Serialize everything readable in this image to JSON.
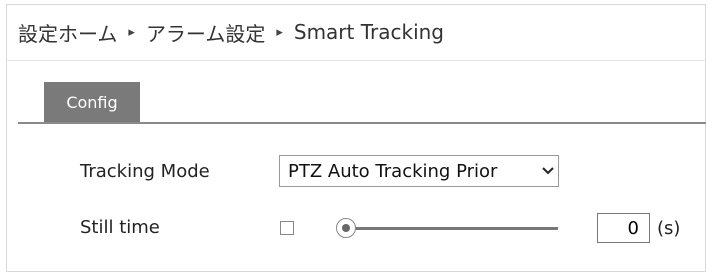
{
  "breadcrumb": {
    "items": [
      "設定ホーム",
      "アラーム設定",
      "Smart Tracking"
    ],
    "separator": "▸"
  },
  "tabs": [
    {
      "label": "Config",
      "active": true
    }
  ],
  "form": {
    "tracking_mode": {
      "label": "Tracking Mode",
      "value": "PTZ Auto Tracking Prior"
    },
    "still_time": {
      "label": "Still time",
      "checked": false,
      "slider_value": 0,
      "value": "0",
      "unit": "(s)"
    }
  },
  "colors": {
    "tab_bg": "#7a7a7a",
    "tab_text": "#ffffff",
    "tab_rule": "#8a8a8a"
  },
  "icons": {
    "select_arrow": "chevron-down-icon",
    "separator": "triangle-right-icon"
  }
}
